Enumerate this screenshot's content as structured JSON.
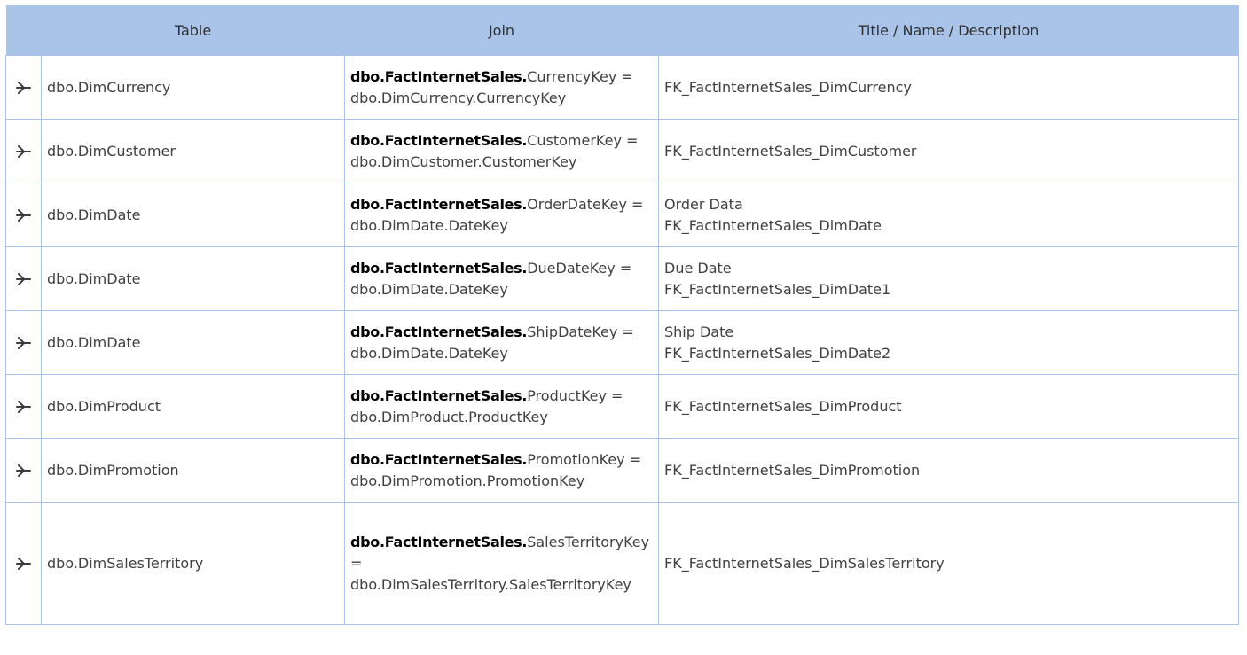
{
  "header": {
    "col_icon": "",
    "col_table": "Table",
    "col_join": "Join",
    "col_desc": "Title / Name / Description"
  },
  "icons": {
    "row_icon": "relationship-fork-icon"
  },
  "colors": {
    "header_bg": "#a9c4e8",
    "border": "#a9c4e8"
  },
  "rows": [
    {
      "table": "dbo.DimCurrency",
      "join_source": "dbo.FactInternetSales.",
      "join_source_col": "CurrencyKey =",
      "join_target": "dbo.DimCurrency.CurrencyKey",
      "title": "",
      "name": "FK_FactInternetSales_DimCurrency"
    },
    {
      "table": "dbo.DimCustomer",
      "join_source": "dbo.FactInternetSales.",
      "join_source_col": "CustomerKey =",
      "join_target": "dbo.DimCustomer.CustomerKey",
      "title": "",
      "name": "FK_FactInternetSales_DimCustomer"
    },
    {
      "table": "dbo.DimDate",
      "join_source": "dbo.FactInternetSales.",
      "join_source_col": "OrderDateKey =",
      "join_target": "dbo.DimDate.DateKey",
      "title": "Order Data",
      "name": "FK_FactInternetSales_DimDate"
    },
    {
      "table": "dbo.DimDate",
      "join_source": "dbo.FactInternetSales.",
      "join_source_col": "DueDateKey =",
      "join_target": "dbo.DimDate.DateKey",
      "title": "Due Date",
      "name": "FK_FactInternetSales_DimDate1"
    },
    {
      "table": "dbo.DimDate",
      "join_source": "dbo.FactInternetSales.",
      "join_source_col": "ShipDateKey =",
      "join_target": "dbo.DimDate.DateKey",
      "title": "Ship Date",
      "name": "FK_FactInternetSales_DimDate2"
    },
    {
      "table": "dbo.DimProduct",
      "join_source": "dbo.FactInternetSales.",
      "join_source_col": "ProductKey =",
      "join_target": "dbo.DimProduct.ProductKey",
      "title": "",
      "name": "FK_FactInternetSales_DimProduct"
    },
    {
      "table": "dbo.DimPromotion",
      "join_source": "dbo.FactInternetSales.",
      "join_source_col": "PromotionKey =",
      "join_target": "dbo.DimPromotion.PromotionKey",
      "title": "",
      "name": "FK_FactInternetSales_DimPromotion"
    },
    {
      "table": "dbo.DimSalesTerritory",
      "join_source": "dbo.FactInternetSales.",
      "join_source_col": "SalesTerritoryKey =",
      "join_target": "dbo.DimSalesTerritory.SalesTerritoryKey",
      "title": "",
      "name": "FK_FactInternetSales_DimSalesTerritory"
    }
  ]
}
